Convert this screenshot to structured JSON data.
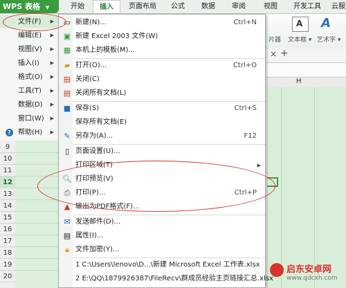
{
  "app": {
    "wps_label": "WPS 表格",
    "tabs": [
      "开始",
      "插入",
      "页面布局",
      "公式",
      "数据",
      "审阅",
      "视图",
      "开发工具",
      "云服"
    ]
  },
  "ribbon": {
    "textbox_label": "文本框",
    "art_label": "艺术字",
    "slicer_label": "片器"
  },
  "sheet": {
    "column_h": "H",
    "rows": [
      "9",
      "10",
      "11",
      "12",
      "13",
      "14",
      "15",
      "16",
      "17",
      "18",
      "19",
      "20"
    ]
  },
  "app_menu": {
    "items": [
      {
        "label": "文件(F)"
      },
      {
        "label": "编辑(E)"
      },
      {
        "label": "视图(V)"
      },
      {
        "label": "插入(I)"
      },
      {
        "label": "格式(O)"
      },
      {
        "label": "工具(T)"
      },
      {
        "label": "数据(D)"
      },
      {
        "label": "窗口(W)"
      },
      {
        "label": "帮助(H)"
      }
    ]
  },
  "file_menu": {
    "new": {
      "label": "新建(N)...",
      "shortcut": "Ctrl+N"
    },
    "new_2003": {
      "label": "新建 Excel 2003 文件(W)"
    },
    "templates": {
      "label": "本机上的模板(M)..."
    },
    "open": {
      "label": "打开(O)...",
      "shortcut": "Ctrl+O"
    },
    "close": {
      "label": "关闭(C)"
    },
    "close_all": {
      "label": "关闭所有文档(L)"
    },
    "save": {
      "label": "保存(S)",
      "shortcut": "Ctrl+S"
    },
    "save_all": {
      "label": "保存所有文档(E)"
    },
    "save_as": {
      "label": "另存为(A)...",
      "shortcut": "F12"
    },
    "page_setup": {
      "label": "页面设置(U)..."
    },
    "print_area": {
      "label": "打印区域(T)"
    },
    "print_preview": {
      "label": "打印预览(V)"
    },
    "print": {
      "label": "打印(P)...",
      "shortcut": "Ctrl+P"
    },
    "export_pdf": {
      "label": "输出为PDF格式(F)..."
    },
    "send_mail": {
      "label": "发送邮件(D)..."
    },
    "properties": {
      "label": "属性(I)..."
    },
    "encrypt": {
      "label": "文件加密(Y)..."
    },
    "recent_1": {
      "label": "1 C:\\Users\\lenovo\\D...\\新建 Microsoft Excel 工作表.xlsx"
    },
    "recent_2": {
      "label": "2 E:\\QQ\\1879926387\\FileRecv\\群成员经验主页链接汇总.xlsx"
    }
  },
  "watermark": {
    "title": "启东安卓网",
    "url": "www.qdcxh.com"
  },
  "colors": {
    "accent_green": "#3a9c3f",
    "highlight_red": "#d9342b"
  }
}
